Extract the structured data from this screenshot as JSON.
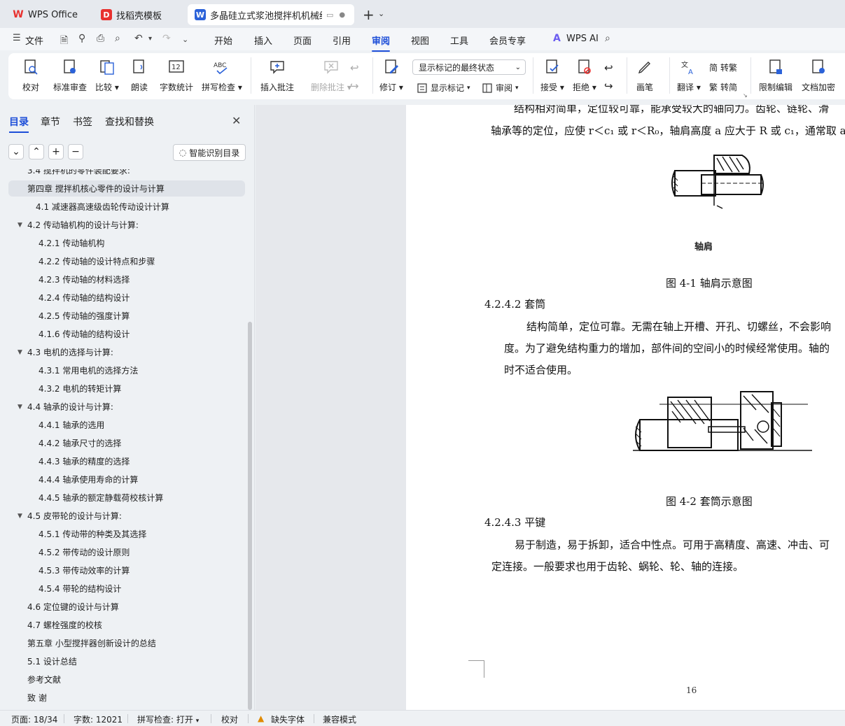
{
  "tabs": [
    {
      "label": "WPS Office",
      "icon": "wps-logo-icon",
      "color": "#e8312f"
    },
    {
      "label": "找稻壳模板",
      "icon": "docer-logo-icon",
      "color": "#e8312f"
    },
    {
      "label": "多晶硅立式浆池搅拌机机械结",
      "icon": "writer-logo-icon",
      "color": "#2b62d9"
    }
  ],
  "menu": {
    "file": "文件",
    "items": [
      "开始",
      "插入",
      "页面",
      "引用",
      "审阅",
      "视图",
      "工具",
      "会员专享"
    ],
    "active": "审阅",
    "ai": "WPS AI"
  },
  "ribbon": {
    "proofread": "校对",
    "std_review": "标准审查",
    "compare": "比较",
    "read_aloud": "朗读",
    "word_count": "字数统计",
    "spell_check": "拼写检查",
    "insert_comment": "插入批注",
    "delete_comment": "删除批注",
    "revise": "修订",
    "markup_dropdown": "显示标记的最终状态",
    "show_markup": "显示标记",
    "review": "审阅",
    "accept": "接受",
    "reject": "拒绝",
    "pen": "画笔",
    "translate": "翻译",
    "to_trad": "转繁",
    "to_simp": "转简",
    "restrict": "限制编辑",
    "encrypt": "文档加密"
  },
  "nav": {
    "tabs": [
      "目录",
      "章节",
      "书签",
      "查找和替换"
    ],
    "smart_btn": "智能识别目录",
    "toc": [
      {
        "text": "3.4 搅拌机的零件装配要求:",
        "level": 1,
        "arrow": false
      },
      {
        "text": "第四章  搅拌机核心零件的设计与计算",
        "level": 1,
        "arrow": false,
        "selected": true
      },
      {
        "text": "4.1 减速器高速级齿轮传动设计计算",
        "level": 2,
        "arrow": false
      },
      {
        "text": "4.2 传动轴机构的设计与计算:",
        "level": 1,
        "arrow": true
      },
      {
        "text": "4.2.1 传动轴机构",
        "level": 3,
        "arrow": false
      },
      {
        "text": "4.2.2  传动轴的设计特点和步骤",
        "level": 3,
        "arrow": false
      },
      {
        "text": "4.2.3  传动轴的材料选择",
        "level": 3,
        "arrow": false
      },
      {
        "text": "4.2.4  传动轴的结构设计",
        "level": 3,
        "arrow": false
      },
      {
        "text": "4.2.5  传动轴的强度计算",
        "level": 3,
        "arrow": false
      },
      {
        "text": "4.1.6  传动轴的结构设计",
        "level": 3,
        "arrow": false
      },
      {
        "text": "4.3 电机的选择与计算:",
        "level": 1,
        "arrow": true
      },
      {
        "text": "4.3.1 常用电机的选择方法",
        "level": 3,
        "arrow": false
      },
      {
        "text": "4.3.2 电机的转矩计算",
        "level": 3,
        "arrow": false
      },
      {
        "text": "4.4 轴承的设计与计算:",
        "level": 1,
        "arrow": true
      },
      {
        "text": "4.4.1 轴承的选用",
        "level": 3,
        "arrow": false
      },
      {
        "text": "4.4.2 轴承尺寸的选择",
        "level": 3,
        "arrow": false
      },
      {
        "text": "4.4.3 轴承的精度的选择",
        "level": 3,
        "arrow": false
      },
      {
        "text": "4.4.4 轴承使用寿命的计算",
        "level": 3,
        "arrow": false
      },
      {
        "text": "4.4.5 轴承的额定静载荷校核计算",
        "level": 3,
        "arrow": false
      },
      {
        "text": "4.5 皮带轮的设计与计算:",
        "level": 1,
        "arrow": true
      },
      {
        "text": "4.5.1 传动带的种类及其选择",
        "level": 3,
        "arrow": false
      },
      {
        "text": "4.5.2 带传动的设计原则",
        "level": 3,
        "arrow": false
      },
      {
        "text": "4.5.3 带传动效率的计算",
        "level": 3,
        "arrow": false
      },
      {
        "text": "4.5.4 带轮的结构设计",
        "level": 3,
        "arrow": false
      },
      {
        "text": "4.6 定位键的设计与计算",
        "level": 1,
        "arrow": false
      },
      {
        "text": "4.7 螺栓强度的校核",
        "level": 1,
        "arrow": false
      },
      {
        "text": "第五章  小型搅拌器创新设计的总结",
        "level": 1,
        "arrow": false
      },
      {
        "text": "5.1 设计总结",
        "level": 1,
        "arrow": false
      },
      {
        "text": "参考文献",
        "level": 1,
        "arrow": false
      },
      {
        "text": "致    谢",
        "level": 1,
        "arrow": false
      }
    ]
  },
  "doc": {
    "line0": "结构相对简单，定位较可靠，能承受较大的轴向力。齿轮、链轮、滑",
    "line1": "轴承等的定位，应使 r＜c₁ 或 r＜R₀，轴肩高度 a 应大于 R 或 c₁，通常取 a",
    "fig1_label": "轴肩",
    "fig1_caption": "图 4-1     轴肩示意图",
    "h_sleeve": "4.2.4.2 套筒",
    "sleeve1": "结构简单，定位可靠。无需在轴上开槽、开孔、切螺丝，不会影响",
    "sleeve2": "度。为了避免结构重力的增加，部件间的空间小的时候经常使用。轴的",
    "sleeve3": "时不适合使用。",
    "fig2_caption": "图 4-2     套筒示意图",
    "h_key": "4.2.4.3 平键",
    "key1": "易于制造，易于拆卸，适合中性点。可用于高精度、高速、冲击、可",
    "key2": "定连接。一般要求也用于齿轮、蜗轮、轮、轴的连接。",
    "page_no": "16"
  },
  "status": {
    "page": "页面: 18/34",
    "words": "字数: 12021",
    "spell": "拼写检查: 打开",
    "proof": "校对",
    "missing_font": "缺失字体",
    "compat": "兼容模式"
  }
}
